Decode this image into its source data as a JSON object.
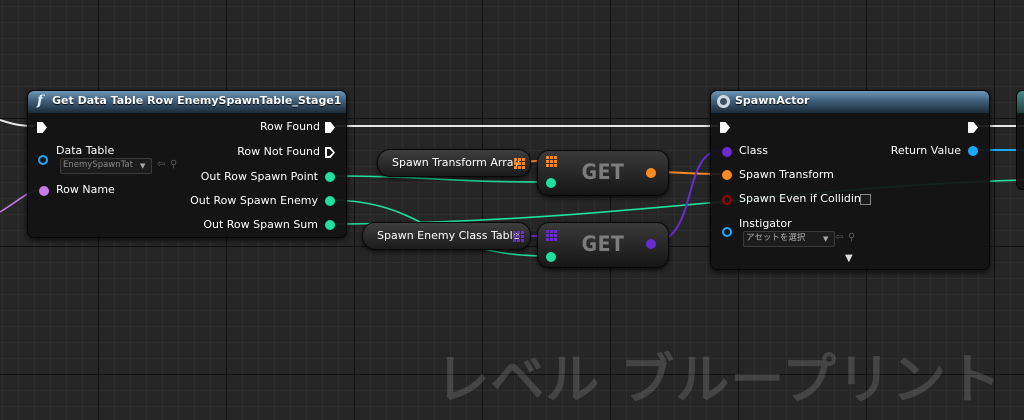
{
  "get_data_table_row": {
    "title": "Get Data Table Row EnemySpawnTable_Stage1",
    "data_table_label": "Data Table",
    "data_table_value": "EnemySpawnTat",
    "row_name_label": "Row Name",
    "row_found_label": "Row Found",
    "row_not_found_label": "Row Not Found",
    "out_spawn_point_label": "Out Row Spawn Point",
    "out_spawn_enemy_label": "Out Row Spawn Enemy",
    "out_spawn_sum_label": "Out Row Spawn Sum"
  },
  "spawn_transform_array": {
    "label": "Spawn Transform Array"
  },
  "spawn_enemy_class_table": {
    "label": "Spawn Enemy Class Table"
  },
  "get_nodes": [
    {
      "label": "GET"
    },
    {
      "label": "GET"
    }
  ],
  "spawn_actor": {
    "title": "SpawnActor",
    "class_label": "Class",
    "spawn_transform_label": "Spawn Transform",
    "spawn_even_label": "Spawn Even if Colliding",
    "instigator_label": "Instigator",
    "instigator_value": "アセットを選択",
    "return_value_label": "Return Value"
  },
  "watermark": "レベル ブループリント",
  "colors": {
    "exec": "#ffffff",
    "struct": "#1fe0a0",
    "transform": "#ff8a1f",
    "class": "#6a2bd1",
    "object": "#1aa8ff",
    "bool": "#8b0000",
    "name": "#c77ce8"
  },
  "icons": {
    "function": "f-function-icon",
    "spawn": "spawn-actor-icon",
    "array": "array-grid-icon",
    "browse": "magnifier-icon",
    "use_selected": "arrow-left-icon"
  }
}
